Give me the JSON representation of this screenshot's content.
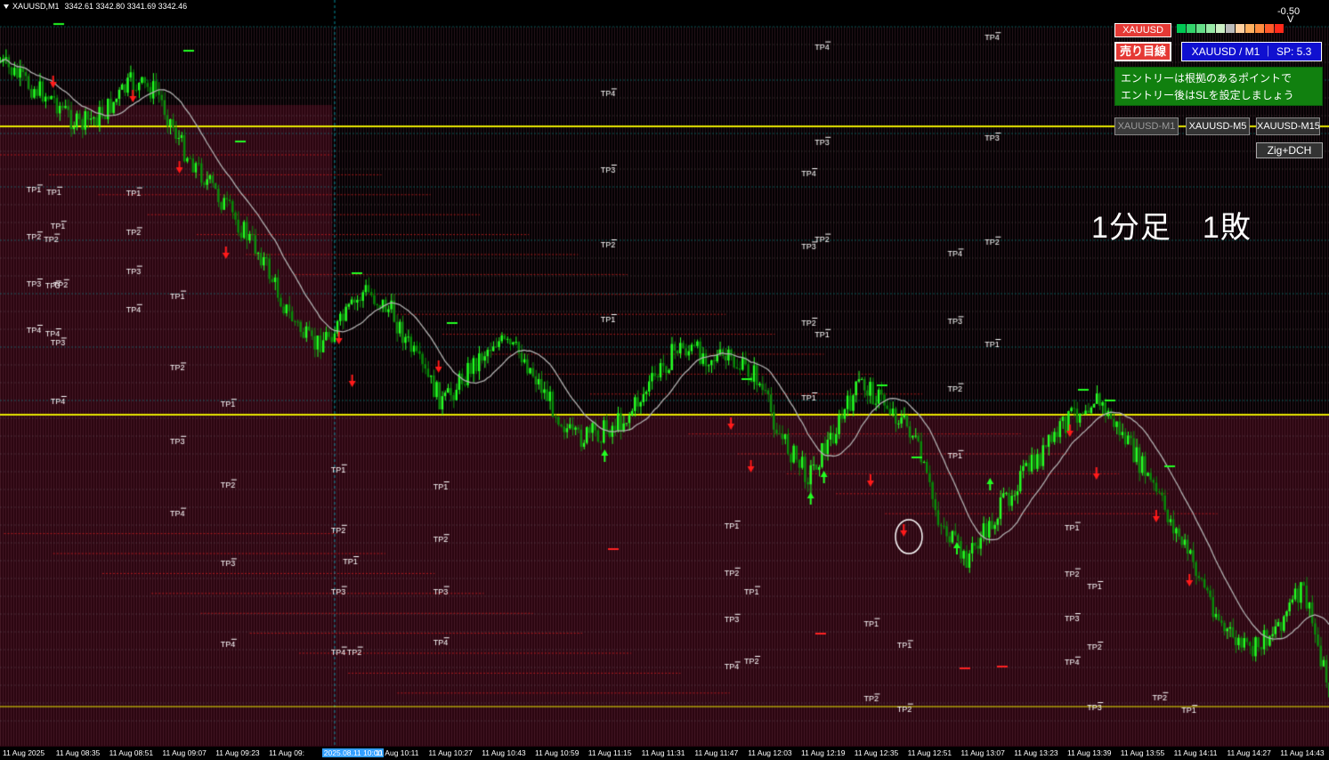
{
  "title": {
    "symbol": "XAUUSD,M1",
    "ohlc": "3342.61 3342.80 3341.69 3342.46"
  },
  "spread_value": "-0.50",
  "v_mark": "V",
  "panel": {
    "symbol_badge": "XAUUSD",
    "sell_badge": "売り目線",
    "symbol_info": "XAUUSD / M1 ｜ SP: 5.3",
    "notice_line1": "エントリーは根拠のあるポイントで",
    "notice_line2": "エントリー後はSLを設定しましょう",
    "tf_m1": "XAUUSD-M1",
    "tf_m5": "XAUUSD-M5",
    "tf_m15": "XAUUSD-M15",
    "zig_label": "Zig+DCH"
  },
  "annotation": "1分足　1敗",
  "colors": {
    "bull": "#22ff22",
    "bear": "#0a8a0a",
    "ma": "#b0b0b0",
    "level": "#e8e800",
    "sell_arrow": "#ff1a1a",
    "buy_arrow": "#22ff22",
    "bg_lower": "#2a0510",
    "bg_upper": "#000000"
  },
  "strength_colors": [
    "#00c853",
    "#33d36b",
    "#66dd88",
    "#99e8a6",
    "#cceec4",
    "#bbbbbb",
    "#ffd0a0",
    "#ffb060",
    "#ff8c40",
    "#ff5a2a",
    "#ff2a1a"
  ],
  "chart_data": {
    "type": "candlestick",
    "symbol": "XAUUSD",
    "timeframe": "M1",
    "last_ohlc": {
      "open": 3342.61,
      "high": 3342.8,
      "low": 3341.69,
      "close": 3342.46
    },
    "x_ticks": [
      "11 Aug 2025",
      "11 Aug 08:35",
      "11 Aug 08:51",
      "11 Aug 09:07",
      "11 Aug 09:23",
      "11 Aug 09:",
      "2025.08.11 10:00",
      "11 Aug 10:11",
      "11 Aug 10:27",
      "11 Aug 10:43",
      "11 Aug 10:59",
      "11 Aug 11:15",
      "11 Aug 11:31",
      "11 Aug 11:47",
      "11 Aug 12:03",
      "11 Aug 12:19",
      "11 Aug 12:35",
      "11 Aug 12:51",
      "11 Aug 13:07",
      "11 Aug 13:23",
      "11 Aug 13:39",
      "11 Aug 13:55",
      "11 Aug 14:11",
      "11 Aug 14:27",
      "11 Aug 14:43"
    ],
    "price_path_rel": [
      0.05,
      0.08,
      0.1,
      0.14,
      0.12,
      0.08,
      0.09,
      0.17,
      0.22,
      0.27,
      0.32,
      0.4,
      0.45,
      0.42,
      0.37,
      0.4,
      0.47,
      0.53,
      0.48,
      0.44,
      0.46,
      0.52,
      0.58,
      0.57,
      0.55,
      0.5,
      0.45,
      0.46,
      0.47,
      0.49,
      0.58,
      0.63,
      0.57,
      0.5,
      0.53,
      0.57,
      0.69,
      0.75,
      0.7,
      0.64,
      0.6,
      0.55,
      0.52,
      0.57,
      0.63,
      0.7,
      0.77,
      0.85,
      0.88,
      0.84,
      0.79,
      0.93
    ],
    "sell_signals_rel": [
      [
        0.04,
        0.08
      ],
      [
        0.1,
        0.1
      ],
      [
        0.135,
        0.2
      ],
      [
        0.17,
        0.32
      ],
      [
        0.255,
        0.44
      ],
      [
        0.265,
        0.5
      ],
      [
        0.33,
        0.48
      ],
      [
        0.55,
        0.56
      ],
      [
        0.565,
        0.62
      ],
      [
        0.655,
        0.64
      ],
      [
        0.68,
        0.71
      ],
      [
        0.805,
        0.57
      ],
      [
        0.825,
        0.63
      ],
      [
        0.87,
        0.69
      ],
      [
        0.895,
        0.78
      ]
    ],
    "buy_signals_rel": [
      [
        0.455,
        0.6
      ],
      [
        0.61,
        0.66
      ],
      [
        0.62,
        0.63
      ],
      [
        0.72,
        0.73
      ],
      [
        0.745,
        0.64
      ]
    ],
    "levels": {
      "yellow_1_rel": 0.14,
      "yellow_2_rel": 0.545,
      "yellow_3_rel": 0.955
    },
    "tp_labels": [
      [
        "TP1",
        0.02,
        0.233
      ],
      [
        "TP1",
        0.035,
        0.236
      ],
      [
        "TP1",
        0.038,
        0.284
      ],
      [
        "TP2",
        0.02,
        0.299
      ],
      [
        "TP2",
        0.033,
        0.302
      ],
      [
        "TP3",
        0.02,
        0.365
      ],
      [
        "TP3",
        0.034,
        0.368
      ],
      [
        "TP2",
        0.04,
        0.366
      ],
      [
        "TP4",
        0.02,
        0.43
      ],
      [
        "TP4",
        0.034,
        0.435
      ],
      [
        "TP3",
        0.038,
        0.448
      ],
      [
        "TP4",
        0.038,
        0.53
      ],
      [
        "TP1",
        0.095,
        0.237
      ],
      [
        "TP2",
        0.095,
        0.293
      ],
      [
        "TP3",
        0.095,
        0.347
      ],
      [
        "TP4",
        0.095,
        0.401
      ],
      [
        "TP1",
        0.128,
        0.382
      ],
      [
        "TP2",
        0.128,
        0.483
      ],
      [
        "TP3",
        0.128,
        0.586
      ],
      [
        "TP4",
        0.128,
        0.687
      ],
      [
        "TP1",
        0.166,
        0.534
      ],
      [
        "TP2",
        0.166,
        0.647
      ],
      [
        "TP3",
        0.166,
        0.758
      ],
      [
        "TP4",
        0.166,
        0.871
      ],
      [
        "TP1",
        0.249,
        0.626
      ],
      [
        "TP2",
        0.249,
        0.711
      ],
      [
        "TP1",
        0.258,
        0.755
      ],
      [
        "TP3",
        0.249,
        0.797
      ],
      [
        "TP4",
        0.249,
        0.882
      ],
      [
        "TP2",
        0.261,
        0.882
      ],
      [
        "TP1",
        0.326,
        0.65
      ],
      [
        "TP2",
        0.326,
        0.724
      ],
      [
        "TP3",
        0.326,
        0.797
      ],
      [
        "TP4",
        0.326,
        0.869
      ],
      [
        "TP4",
        0.452,
        0.098
      ],
      [
        "TP3",
        0.452,
        0.205
      ],
      [
        "TP2",
        0.452,
        0.31
      ],
      [
        "TP1",
        0.452,
        0.415
      ],
      [
        "TP4",
        0.613,
        0.032
      ],
      [
        "TP3",
        0.613,
        0.166
      ],
      [
        "TP4",
        0.603,
        0.21
      ],
      [
        "TP3",
        0.603,
        0.313
      ],
      [
        "TP2",
        0.613,
        0.302
      ],
      [
        "TP2",
        0.603,
        0.42
      ],
      [
        "TP1",
        0.613,
        0.436
      ],
      [
        "TP1",
        0.603,
        0.525
      ],
      [
        "TP1",
        0.545,
        0.705
      ],
      [
        "TP2",
        0.545,
        0.771
      ],
      [
        "TP1",
        0.56,
        0.797
      ],
      [
        "TP3",
        0.545,
        0.836
      ],
      [
        "TP4",
        0.545,
        0.903
      ],
      [
        "TP2",
        0.56,
        0.895
      ],
      [
        "TP1",
        0.65,
        0.842
      ],
      [
        "TP1",
        0.675,
        0.873
      ],
      [
        "TP2",
        0.65,
        0.948
      ],
      [
        "TP2",
        0.675,
        0.962
      ],
      [
        "TP4",
        0.741,
        0.019
      ],
      [
        "TP3",
        0.741,
        0.16
      ],
      [
        "TP4",
        0.713,
        0.323
      ],
      [
        "TP2",
        0.741,
        0.306
      ],
      [
        "TP3",
        0.713,
        0.418
      ],
      [
        "TP1",
        0.741,
        0.45
      ],
      [
        "TP2",
        0.713,
        0.512
      ],
      [
        "TP1",
        0.713,
        0.606
      ],
      [
        "TP1",
        0.801,
        0.707
      ],
      [
        "TP2",
        0.801,
        0.772
      ],
      [
        "TP1",
        0.818,
        0.79
      ],
      [
        "TP3",
        0.801,
        0.835
      ],
      [
        "TP2",
        0.818,
        0.875
      ],
      [
        "TP4",
        0.801,
        0.896
      ],
      [
        "TP3",
        0.818,
        0.96
      ],
      [
        "TP2",
        0.867,
        0.946
      ],
      [
        "TP1",
        0.889,
        0.964
      ]
    ]
  }
}
